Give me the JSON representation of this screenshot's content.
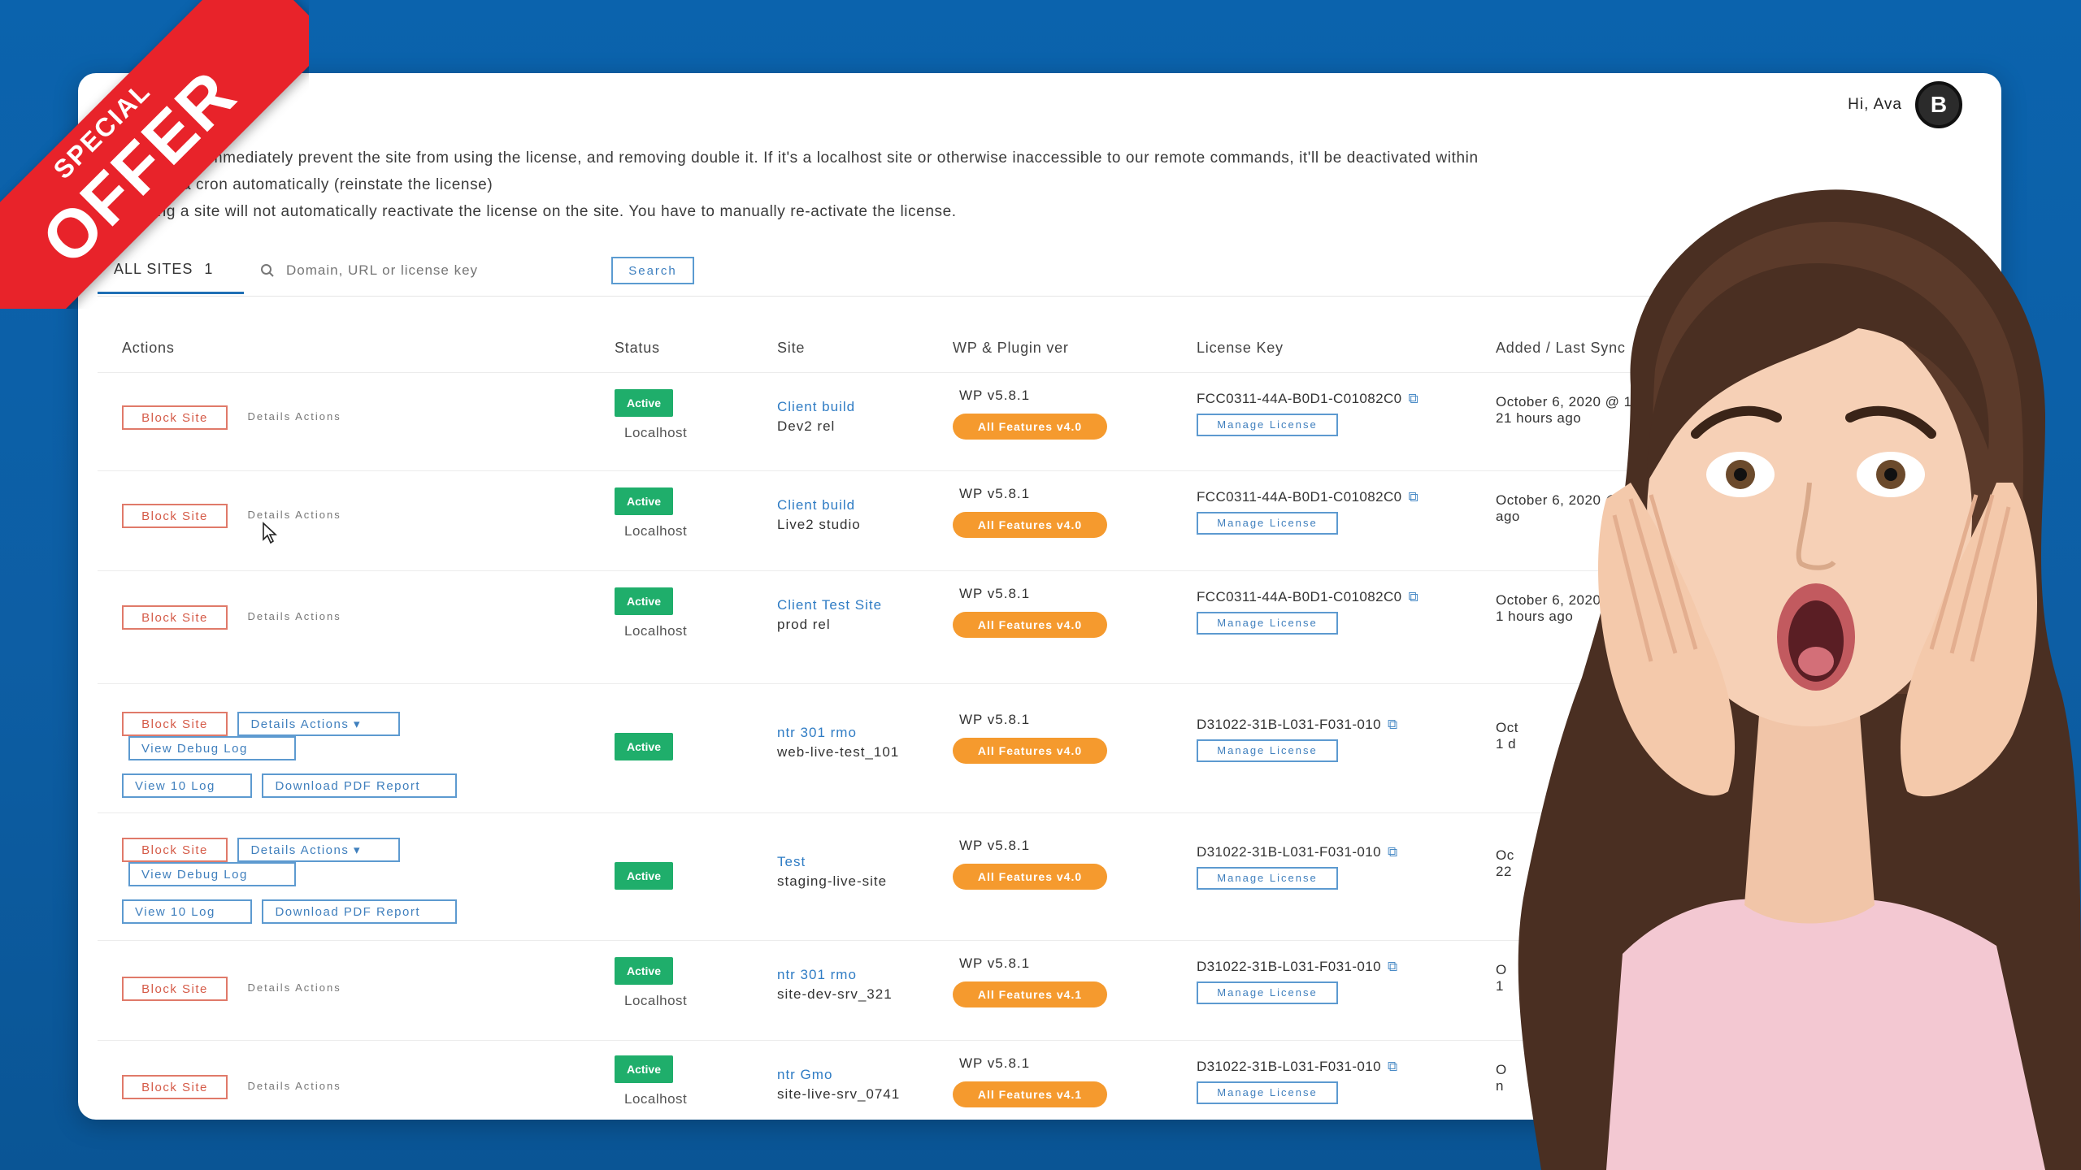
{
  "promo": {
    "ribbon_small": "SPECIAL",
    "ribbon_large": "OFFER"
  },
  "header": {
    "user_name": "Hi, Ava",
    "avatar_initial": "B"
  },
  "notice": {
    "line1": "…ing a file will immediately prevent the site from using the license, and removing double it. If it's a localhost site or otherwise inaccessible to our remote commands, it'll be deactivated within",
    "line2": "…hours via a cron automatically (reinstate the license)",
    "line3": "Unblocking a site will not automatically reactivate the license on the site. You have to manually re-activate the license."
  },
  "toolbar": {
    "tab_all": "ALL SITES",
    "tab_all_count": "1",
    "search_placeholder": "Domain, URL or license key",
    "search_button": "Search"
  },
  "table": {
    "headers": {
      "actions": "Actions",
      "status": "Status",
      "device": "Site",
      "firmware": "WP & Plugin ver",
      "license": "License Key",
      "last": "Added / Last Sync"
    },
    "rows": [
      {
        "block": "Block Site",
        "details": "Details Actions",
        "status": "Active",
        "status_sub": "Localhost",
        "dev_name": "Client build",
        "dev_sub": "Dev2 rel",
        "fw": "WP v5.8.1",
        "pill": "All Features v4.0",
        "lic": "FCC0311-44A-B0D1-C01082C0",
        "lic_btn": "Manage License",
        "last1": "October 6, 2020 @ 11:03",
        "last2": "21 hours ago"
      },
      {
        "block": "Block Site",
        "details": "Details Actions",
        "status": "Active",
        "status_sub": "Localhost",
        "dev_name": "Client build",
        "dev_sub": "Live2 studio",
        "fw": "WP v5.8.1",
        "pill": "All Features v4.0",
        "lic": "FCC0311-44A-B0D1-C01082C0",
        "lic_btn": "Manage License",
        "last1": "October 6, 2020 @ 14:11",
        "last2": "ago"
      },
      {
        "block": "Block Site",
        "details": "Details Actions",
        "status": "Active",
        "status_sub": "Localhost",
        "dev_name": "Client Test Site",
        "dev_sub": "prod rel",
        "fw": "WP v5.8.1",
        "pill": "All Features v4.0",
        "lic": "FCC0311-44A-B0D1-C01082C0",
        "lic_btn": "Manage License",
        "last1": "October 6, 2020 @ 0:03 pm",
        "last2": "1 hours ago"
      },
      {
        "block": "Block Site",
        "details": "Details Actions ▾",
        "view_debug": "View Debug Log",
        "view_log": "View 10 Log",
        "download": "Download PDF Report",
        "status": "Active",
        "status_sub": "",
        "dev_name": "ntr 301 rmo",
        "dev_sub": "web-live-test_101",
        "fw": "WP v5.8.1",
        "pill": "All Features v4.0",
        "lic": "D31022-31B-L031-F031-010",
        "lic_btn": "Manage License",
        "last1": "Oct",
        "last2": "1 d"
      },
      {
        "block": "Block Site",
        "details": "Details Actions ▾",
        "view_debug": "View Debug Log",
        "view_log": "View 10 Log",
        "download": "Download PDF Report",
        "status": "Active",
        "status_sub": "",
        "dev_name": "Test",
        "dev_sub": "staging-live-site",
        "fw": "WP v5.8.1",
        "pill": "All Features v4.0",
        "lic": "D31022-31B-L031-F031-010",
        "lic_btn": "Manage License",
        "last1": "Oc",
        "last2": "22"
      },
      {
        "block": "Block Site",
        "details": "Details Actions",
        "status": "Active",
        "status_sub": "Localhost",
        "dev_name": "ntr 301 rmo",
        "dev_sub": "site-dev-srv_321",
        "fw": "WP v5.8.1",
        "pill": "All Features v4.1",
        "lic": "D31022-31B-L031-F031-010",
        "lic_btn": "Manage License",
        "last1": "O",
        "last2": "1"
      },
      {
        "block": "Block Site",
        "details": "Details Actions",
        "status": "Active",
        "status_sub": "Localhost",
        "dev_name": "ntr Gmo",
        "dev_sub": "site-live-srv_0741",
        "fw": "WP v5.8.1",
        "pill": "All Features v4.1",
        "lic": "D31022-31B-L031-F031-010",
        "lic_btn": "Manage License",
        "last1": "O",
        "last2": "n"
      }
    ]
  },
  "icons": {
    "search": "search-icon",
    "copy": "copy-icon",
    "cursor": "mouse-pointer-icon"
  },
  "colors": {
    "background": "#0d5ea4",
    "ribbon": "#e8232a",
    "active_badge": "#1fae6b",
    "pill": "#f59a2e",
    "link_blue": "#2f7cc4",
    "block_red": "#d55b48"
  }
}
